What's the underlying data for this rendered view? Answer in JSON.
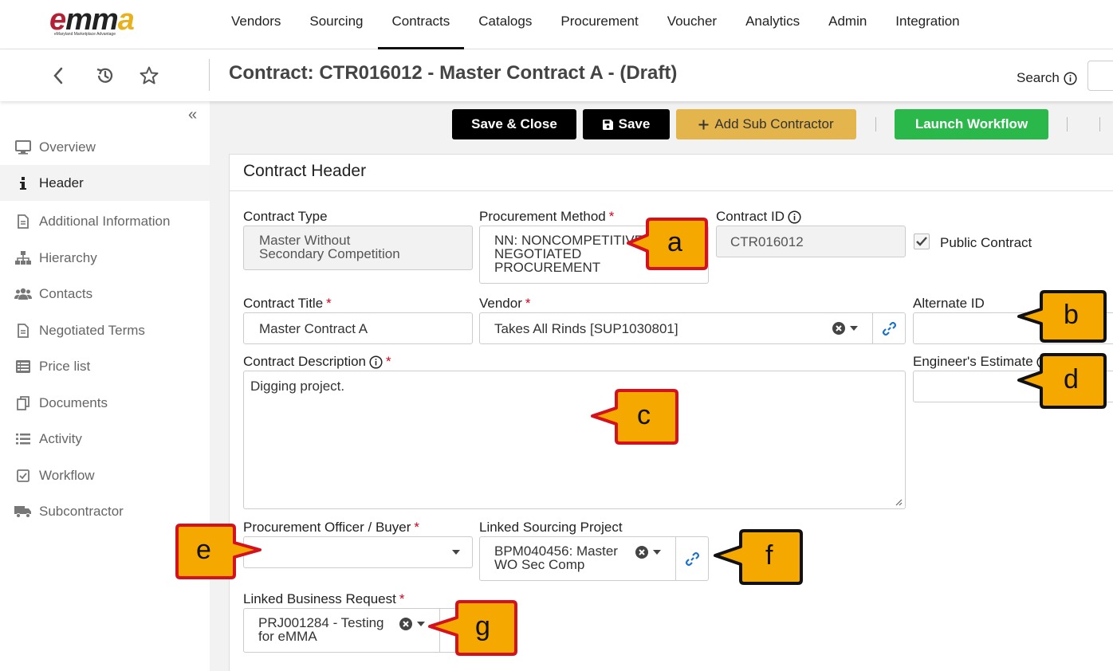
{
  "logo": {
    "e": "e",
    "mm": "mm",
    "a": "a",
    "tagline": "eMaryland Marketplace Advantage"
  },
  "nav": [
    "Vendors",
    "Sourcing",
    "Contracts",
    "Catalogs",
    "Procurement",
    "Voucher",
    "Analytics",
    "Admin",
    "Integration"
  ],
  "nav_active": "Contracts",
  "page_title": "Contract: CTR016012 - Master Contract A - (Draft)",
  "search_label": "Search",
  "sidebar": {
    "items": [
      {
        "label": "Overview",
        "icon": "monitor-icon"
      },
      {
        "label": "Header",
        "icon": "info-icon"
      },
      {
        "label": "Additional Information",
        "icon": "document-icon"
      },
      {
        "label": "Hierarchy",
        "icon": "hierarchy-icon"
      },
      {
        "label": "Contacts",
        "icon": "users-icon"
      },
      {
        "label": "Negotiated Terms",
        "icon": "document-icon"
      },
      {
        "label": "Price list",
        "icon": "list-icon"
      },
      {
        "label": "Documents",
        "icon": "copy-icon"
      },
      {
        "label": "Activity",
        "icon": "activity-list-icon"
      },
      {
        "label": "Workflow",
        "icon": "checkbox-icon"
      },
      {
        "label": "Subcontractor",
        "icon": "truck-icon"
      }
    ],
    "active": "Header"
  },
  "toolbar": {
    "save_close": "Save & Close",
    "save": "Save",
    "add_sub": "Add Sub Contractor",
    "launch": "Launch Workflow"
  },
  "card": {
    "title": "Contract Header",
    "contract_type": {
      "label": "Contract Type",
      "value_line1": "Master Without",
      "value_line2": "Secondary Competition"
    },
    "procurement_method": {
      "label": "Procurement Method",
      "value_line1": "NN: NONCOMPETITIVE",
      "value_line2": "NEGOTIATED",
      "value_line3": "PROCUREMENT"
    },
    "contract_id": {
      "label": "Contract ID",
      "value": "CTR016012"
    },
    "public_contract": {
      "label": "Public Contract",
      "checked": true
    },
    "contract_title": {
      "label": "Contract Title",
      "value": "Master Contract A"
    },
    "vendor": {
      "label": "Vendor",
      "value": "Takes All Rinds [SUP1030801]"
    },
    "alternate_id": {
      "label": "Alternate ID",
      "value": ""
    },
    "description": {
      "label": "Contract Description",
      "value": "Digging project."
    },
    "engineers_estimate": {
      "label": "Engineer's Estimate",
      "value": ""
    },
    "officer": {
      "label": "Procurement Officer / Buyer",
      "value": ""
    },
    "sourcing_project": {
      "label": "Linked Sourcing Project",
      "value_line1": "BPM040456: Master",
      "value_line2": "WO Sec Comp"
    },
    "business_request": {
      "label": "Linked Business Request",
      "value_line1": "PRJ001284 - Testing",
      "value_line2": "for eMMA"
    }
  },
  "callouts": [
    "a",
    "b",
    "c",
    "d",
    "e",
    "f",
    "g"
  ],
  "colors": {
    "callout_fill": "#f5a800",
    "callout_red": "#d4121e",
    "green": "#2bb84a",
    "gold": "#e4b44d"
  }
}
